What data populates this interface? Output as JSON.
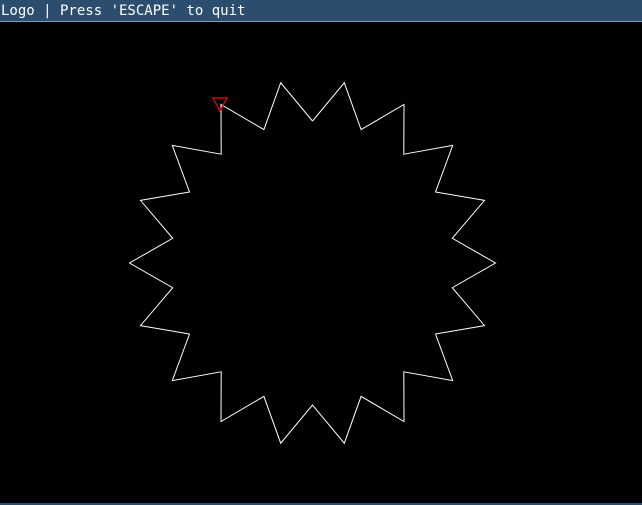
{
  "window": {
    "title": "Logo | Press 'ESCAPE' to quit"
  },
  "canvas": {
    "background_color": "#000000",
    "shape": "star-polygon",
    "star_points": 18,
    "line_color": "#ffffff"
  },
  "turtle": {
    "icon": "triangle-turtle-icon",
    "color": "#ff0000"
  },
  "colors": {
    "titlebar": "#2b4d6e",
    "titlebar_border": "#7f9bb8",
    "title_text": "#ffffff"
  }
}
